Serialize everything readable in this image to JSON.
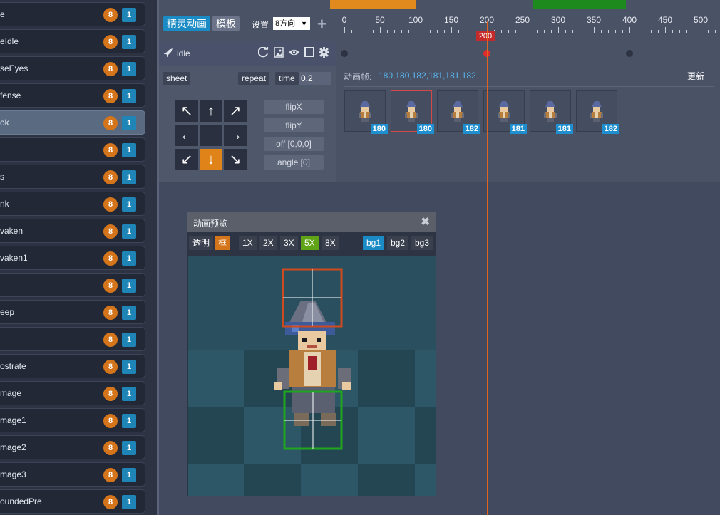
{
  "sidebar": {
    "items": [
      {
        "name": "e",
        "dirs": "8",
        "frames": "1"
      },
      {
        "name": "eIdle",
        "dirs": "8",
        "frames": "1"
      },
      {
        "name": "seEyes",
        "dirs": "8",
        "frames": "1"
      },
      {
        "name": "fense",
        "dirs": "8",
        "frames": "1"
      },
      {
        "name": "ok",
        "dirs": "8",
        "frames": "1",
        "selected": true
      },
      {
        "name": "",
        "dirs": "8",
        "frames": "1"
      },
      {
        "name": "s",
        "dirs": "8",
        "frames": "1"
      },
      {
        "name": "nk",
        "dirs": "8",
        "frames": "1"
      },
      {
        "name": "vaken",
        "dirs": "8",
        "frames": "1"
      },
      {
        "name": "vaken1",
        "dirs": "8",
        "frames": "1"
      },
      {
        "name": "",
        "dirs": "8",
        "frames": "1"
      },
      {
        "name": "eep",
        "dirs": "8",
        "frames": "1"
      },
      {
        "name": "",
        "dirs": "8",
        "frames": "1"
      },
      {
        "name": "ostrate",
        "dirs": "8",
        "frames": "1"
      },
      {
        "name": "mage",
        "dirs": "8",
        "frames": "1"
      },
      {
        "name": "mage1",
        "dirs": "8",
        "frames": "1"
      },
      {
        "name": "mage2",
        "dirs": "8",
        "frames": "1"
      },
      {
        "name": "mage3",
        "dirs": "8",
        "frames": "1"
      },
      {
        "name": "oundedPre",
        "dirs": "8",
        "frames": "1"
      }
    ]
  },
  "toolbar": {
    "sprite_anim": "精灵动画",
    "template": "模板",
    "settings": "设置",
    "direction": "8方向",
    "direction_arrow": "▼",
    "add_icon": "+"
  },
  "timeline": {
    "ticks": [
      "0",
      "50",
      "100",
      "150",
      "200",
      "250",
      "300",
      "350",
      "400",
      "450",
      "500"
    ],
    "playhead": "200",
    "bar_colors": [
      "#e08a1e",
      "#1d8a1d"
    ]
  },
  "props": {
    "anim_name": "idle",
    "sheet": "sheet",
    "repeat": "repeat",
    "time_label": "time",
    "time_value": "0.2",
    "icons": [
      "rocket-icon",
      "refresh-icon",
      "image-icon",
      "eye-icon",
      "square-icon",
      "gear-icon"
    ],
    "arrows": [
      "↖",
      "↑",
      "↗",
      "←",
      "",
      "→",
      "↙",
      "↓",
      "↘"
    ],
    "active_arrow": "↓",
    "options": [
      "flipX",
      "flipY",
      "off [0,0,0]",
      "angle [0]"
    ]
  },
  "frames": {
    "label": "动画帧:",
    "value": "180,180,182,181,181,182",
    "refresh": "更新",
    "thumbs": [
      "180",
      "180",
      "182",
      "181",
      "181",
      "182"
    ],
    "selected_index": 1
  },
  "preview": {
    "title": "动画预览",
    "close": "✖",
    "transparent": "透明",
    "frame": "框",
    "zooms": [
      "1X",
      "2X",
      "3X",
      "5X",
      "8X"
    ],
    "active_zoom": "5X",
    "backgrounds": [
      "bg1",
      "bg2",
      "bg3"
    ],
    "active_background": "bg1"
  },
  "colors": {
    "accent_blue": "#1a8bc4",
    "badge_orange": "#d5751b",
    "active_zoom_green": "#5fa316",
    "playhead_red": "#c52a2a"
  }
}
